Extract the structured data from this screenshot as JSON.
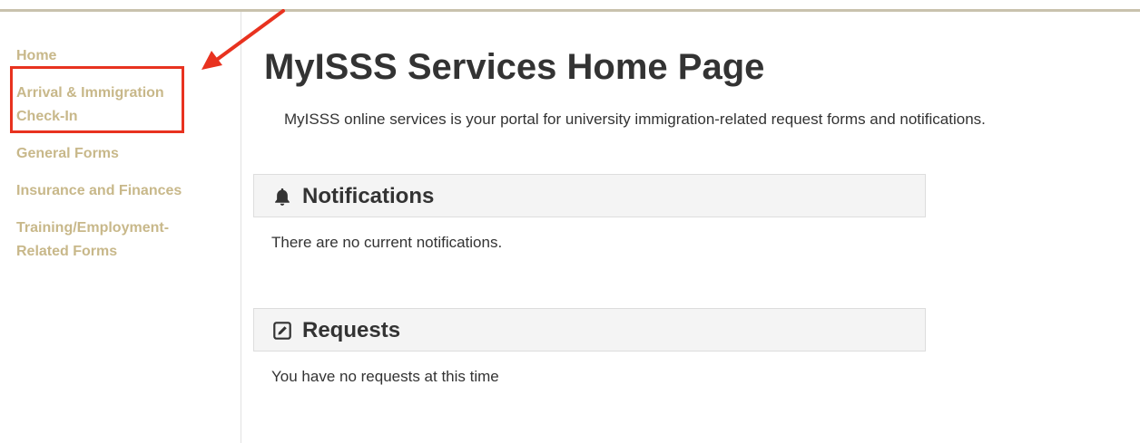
{
  "sidebar": {
    "items": [
      {
        "label": "Home"
      },
      {
        "label": "Arrival & Immigration Check-In"
      },
      {
        "label": "General Forms"
      },
      {
        "label": "Insurance and Finances"
      },
      {
        "label": "Training/Employment-Related Forms"
      }
    ]
  },
  "page": {
    "title": "MyISSS Services Home Page",
    "intro": "MyISSS online services is your portal for university immigration-related request forms and notifications."
  },
  "notifications": {
    "title": "Notifications",
    "icon": "bell-icon",
    "message": "There are no current notifications."
  },
  "requests": {
    "title": "Requests",
    "icon": "edit-icon",
    "message": "You have no requests at this time"
  },
  "annotation": {
    "arrow_color": "#e8321f",
    "box_color": "#e8321f"
  }
}
